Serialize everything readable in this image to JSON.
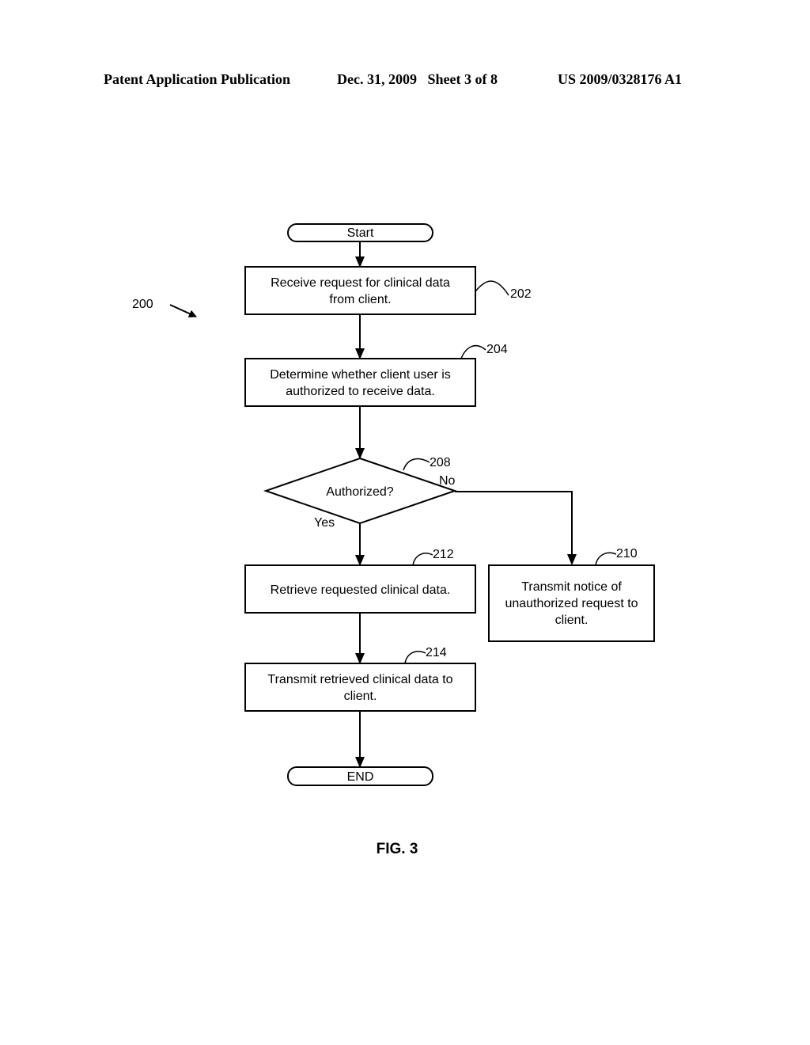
{
  "header": {
    "publication": "Patent Application Publication",
    "date_sheet": "Dec. 31, 2009   Sheet 3 of 8",
    "number": "US 2009/0328176 A1"
  },
  "figure": {
    "label": "FIG. 3",
    "ref": "200",
    "start": "Start",
    "end": "END",
    "steps": {
      "s202": {
        "ref": "202",
        "lines": [
          "Receive request for clinical data",
          "from client."
        ]
      },
      "s204": {
        "ref": "204",
        "lines": [
          "Determine whether client user is",
          "authorized to receive data."
        ]
      },
      "s208": {
        "ref": "208",
        "text": "Authorized?",
        "yes": "Yes",
        "no": "No"
      },
      "s212": {
        "ref": "212",
        "lines": [
          "Retrieve requested clinical data."
        ]
      },
      "s210": {
        "ref": "210",
        "lines": [
          "Transmit notice of",
          "unauthorized request to",
          "client."
        ]
      },
      "s214": {
        "ref": "214",
        "lines": [
          "Transmit retrieved clinical data to",
          "client."
        ]
      }
    }
  }
}
